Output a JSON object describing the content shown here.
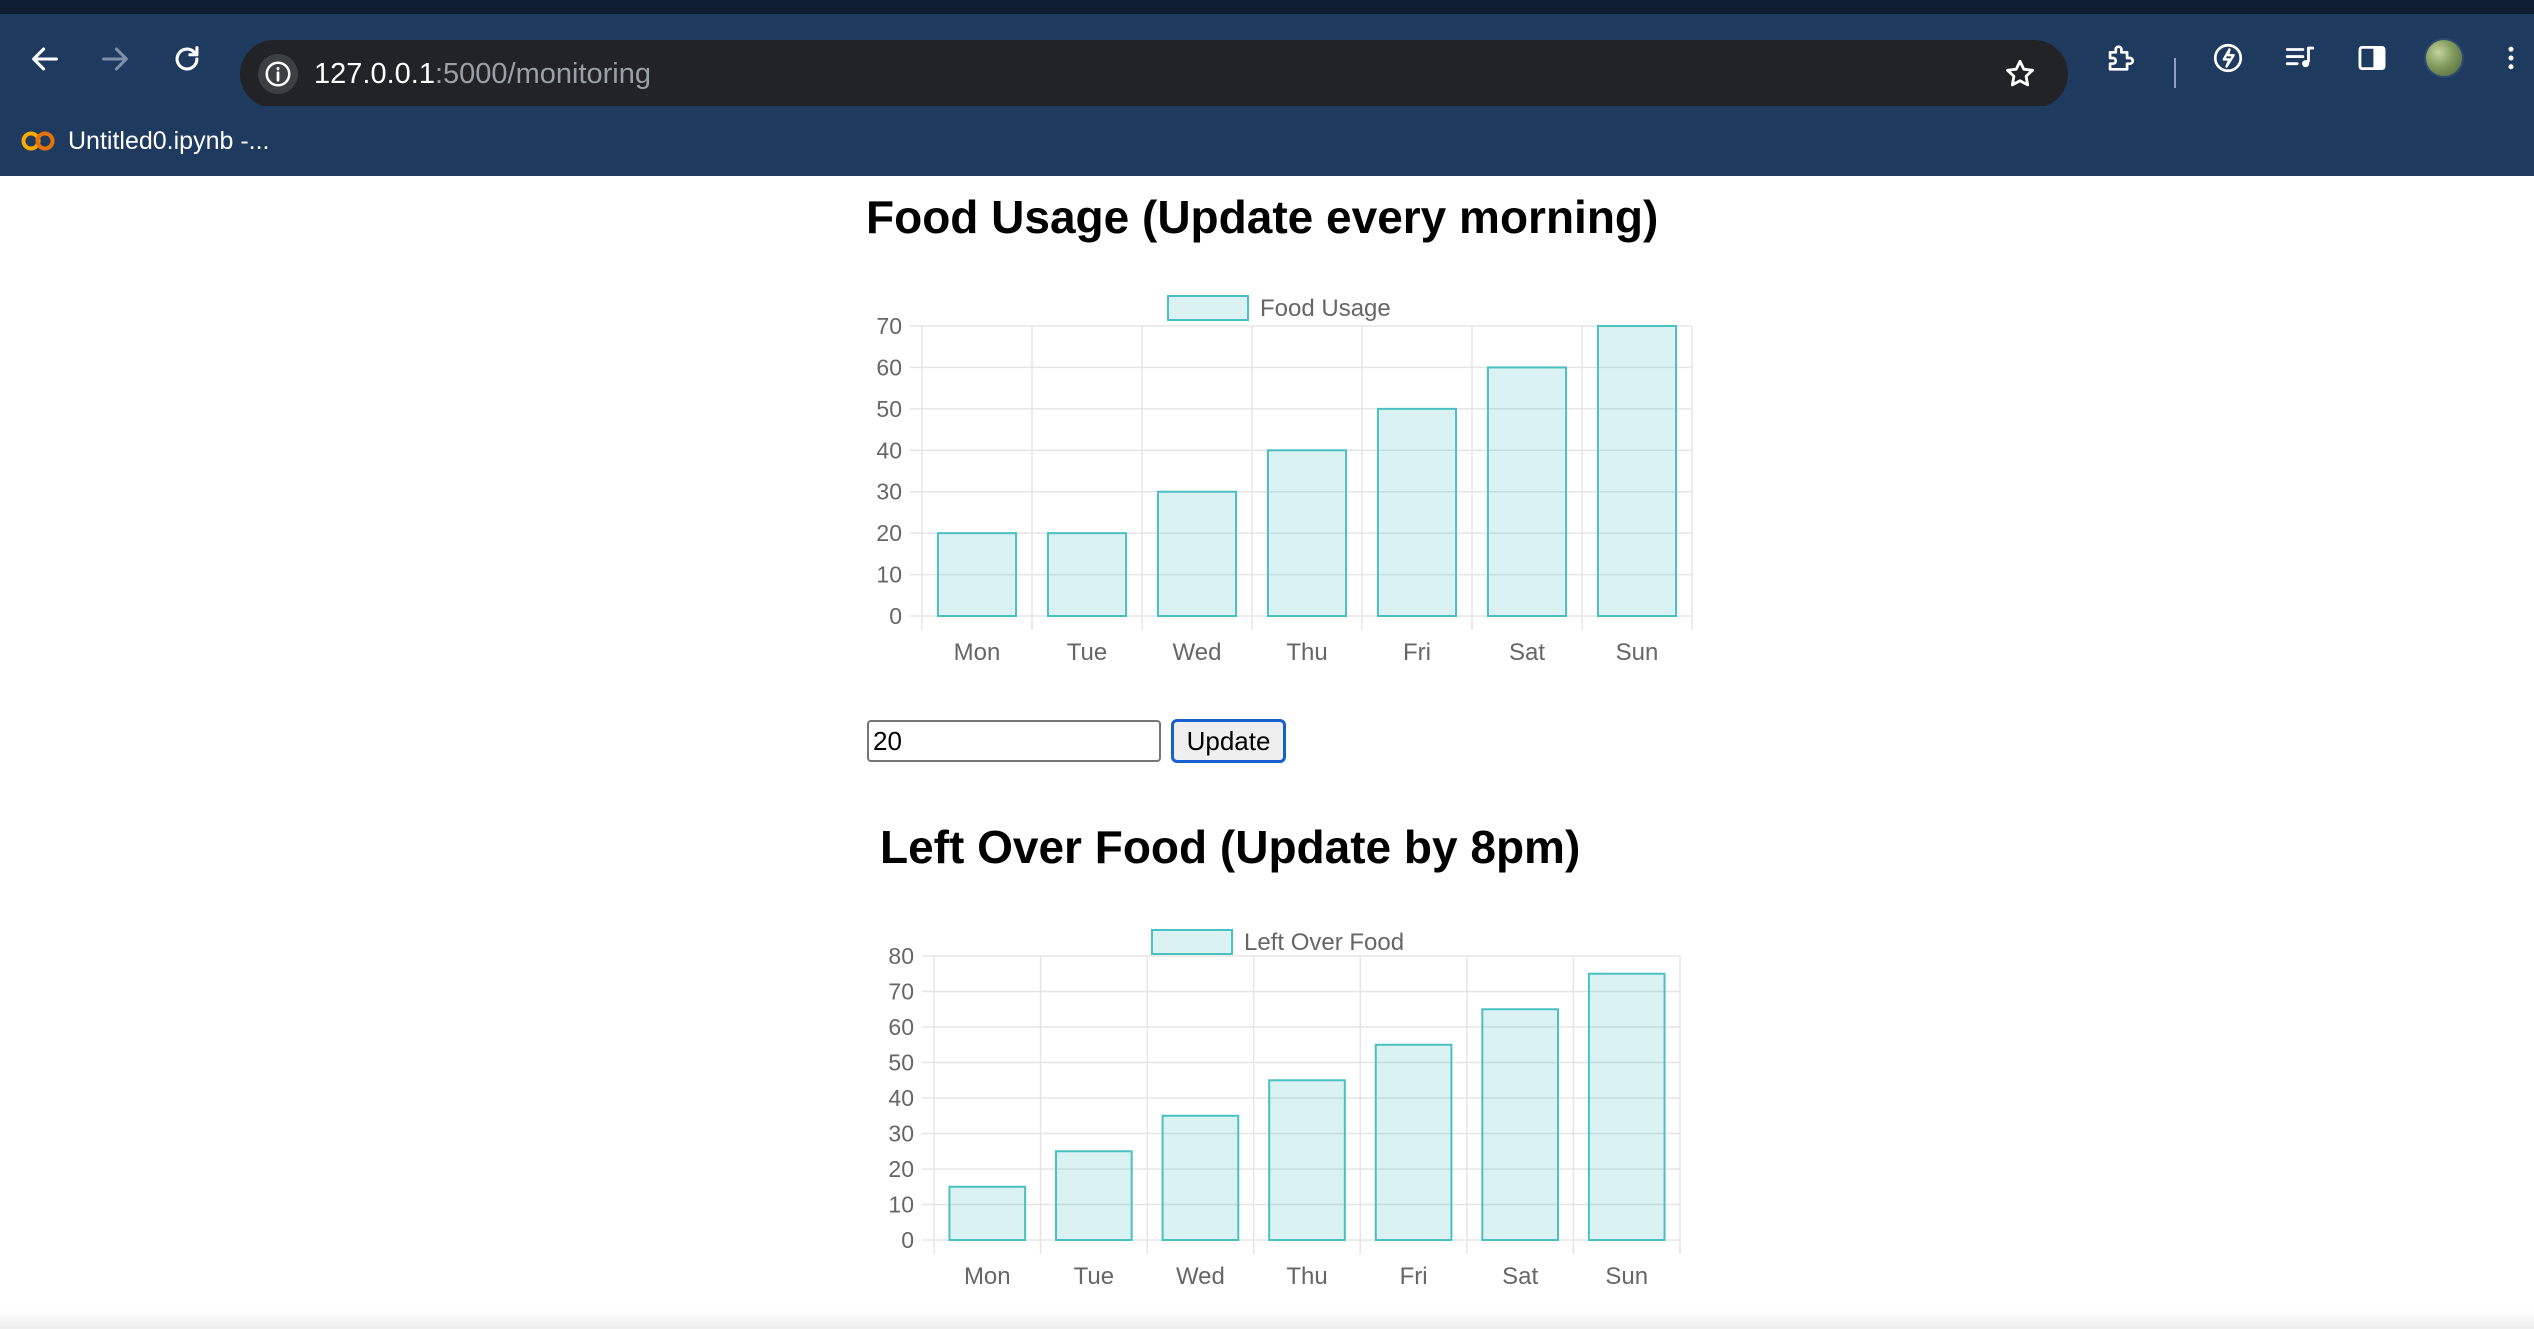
{
  "browser": {
    "url_host": "127.0.0.1",
    "url_path": ":5000/monitoring",
    "bookmarks": [
      {
        "label": "Untitled0.ipynb -..."
      }
    ],
    "icons": {
      "back": "arrow-left-icon",
      "forward": "arrow-right-icon",
      "reload": "reload-icon",
      "site_info": "info-icon",
      "bookmark_star": "star-icon",
      "extensions": "puzzle-icon",
      "performance": "leaf-icon",
      "media": "media-queue-icon",
      "side_panel": "side-panel-icon",
      "menu": "kebab-menu-icon"
    }
  },
  "page": {
    "food_usage": {
      "title": "Food Usage (Update every morning)",
      "input_value": "20",
      "update_label": "Update"
    },
    "left_over": {
      "title": "Left Over Food (Update by 8pm)"
    }
  },
  "colors": {
    "bar_fill": "rgba(75,192,192,0.2)",
    "bar_border": "#4bc0c0",
    "grid": "#e5e5e5",
    "tick_text": "#666666",
    "chrome_bg": "#1e3a5f"
  },
  "chart_data": [
    {
      "type": "bar",
      "categories": [
        "Mon",
        "Tue",
        "Wed",
        "Thu",
        "Fri",
        "Sat",
        "Sun"
      ],
      "series": [
        {
          "name": "Food Usage",
          "values": [
            20,
            20,
            30,
            40,
            50,
            60,
            70
          ]
        }
      ],
      "title": "",
      "xlabel": "",
      "ylabel": "",
      "ylim": [
        0,
        70
      ],
      "yticks": [
        0,
        10,
        20,
        30,
        40,
        50,
        60,
        70
      ],
      "grid": true,
      "legend": "top-center"
    },
    {
      "type": "bar",
      "categories": [
        "Mon",
        "Tue",
        "Wed",
        "Thu",
        "Fri",
        "Sat",
        "Sun"
      ],
      "series": [
        {
          "name": "Left Over Food",
          "values": [
            15,
            25,
            35,
            45,
            55,
            65,
            75
          ]
        }
      ],
      "title": "",
      "xlabel": "",
      "ylabel": "",
      "ylim": [
        0,
        80
      ],
      "yticks": [
        0,
        10,
        20,
        30,
        40,
        50,
        60,
        70,
        80
      ],
      "grid": true,
      "legend": "top-center"
    }
  ]
}
